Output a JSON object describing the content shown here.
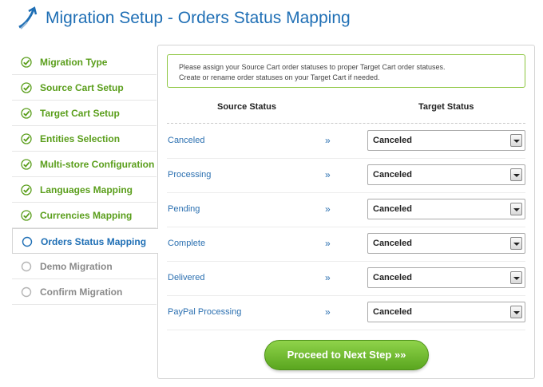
{
  "header": {
    "title": "Migration Setup - Orders Status Mapping",
    "logo_icon": "arrow-logo-icon"
  },
  "sidebar": {
    "items": [
      {
        "label": "Migration Type",
        "state": "done"
      },
      {
        "label": "Source Cart Setup",
        "state": "done"
      },
      {
        "label": "Target Cart Setup",
        "state": "done"
      },
      {
        "label": "Entities Selection",
        "state": "done"
      },
      {
        "label": "Multi-store Configuration",
        "state": "done"
      },
      {
        "label": "Languages Mapping",
        "state": "done"
      },
      {
        "label": "Currencies Mapping",
        "state": "done"
      },
      {
        "label": "Orders Status Mapping",
        "state": "active"
      },
      {
        "label": "Demo Migration",
        "state": "todo"
      },
      {
        "label": "Confirm Migration",
        "state": "todo"
      }
    ]
  },
  "notice": {
    "line1": "Please assign your Source Cart order statuses to proper Target Cart order statuses.",
    "line2": "Create or rename order statuses on your Target Cart if needed."
  },
  "table": {
    "source_header": "Source Status",
    "target_header": "Target Status",
    "arrow": "»",
    "rows": [
      {
        "source": "Canceled",
        "target": "Canceled"
      },
      {
        "source": "Processing",
        "target": "Canceled"
      },
      {
        "source": "Pending",
        "target": "Canceled"
      },
      {
        "source": "Complete",
        "target": "Canceled"
      },
      {
        "source": "Delivered",
        "target": "Canceled"
      },
      {
        "source": "PayPal Processing",
        "target": "Canceled"
      }
    ]
  },
  "proceed_button": {
    "label": "Proceed to Next Step »»"
  },
  "colors": {
    "title": "#1f6fb5",
    "done": "#5a9e1b",
    "active": "#1f6fb5",
    "todo": "#8a8a8a",
    "button": "#6cba2c"
  }
}
